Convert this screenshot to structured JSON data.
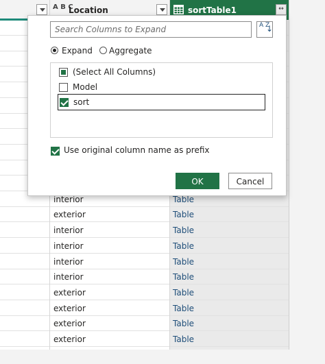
{
  "columns": {
    "location_header": "Location",
    "table_header": "sortTable1",
    "location_type_icon": "A B C"
  },
  "rows": [
    {
      "location": "interior",
      "value": "Table"
    },
    {
      "location": "exterior",
      "value": "Table"
    },
    {
      "location": "interior",
      "value": "Table"
    },
    {
      "location": "interior",
      "value": "Table"
    },
    {
      "location": "interior",
      "value": "Table"
    },
    {
      "location": "interior",
      "value": "Table"
    },
    {
      "location": "exterior",
      "value": "Table"
    },
    {
      "location": "exterior",
      "value": "Table"
    },
    {
      "location": "exterior",
      "value": "Table"
    },
    {
      "location": "exterior",
      "value": "Table"
    }
  ],
  "popup": {
    "search_placeholder": "Search Columns to Expand",
    "sort_icon": "A Z",
    "mode_expand": "Expand",
    "mode_aggregate": "Aggregate",
    "selected_mode": "Expand",
    "columns": [
      {
        "label": "(Select All Columns)",
        "state": "partial"
      },
      {
        "label": "Model",
        "state": "unchecked"
      },
      {
        "label": "sort",
        "state": "checked"
      }
    ],
    "prefix_label": "Use original column name as prefix",
    "prefix_checked": true,
    "ok_label": "OK",
    "cancel_label": "Cancel"
  },
  "colors": {
    "accent": "#217346",
    "header_bg": "#f3f3f3",
    "table_col_bg": "#eaeaea"
  }
}
